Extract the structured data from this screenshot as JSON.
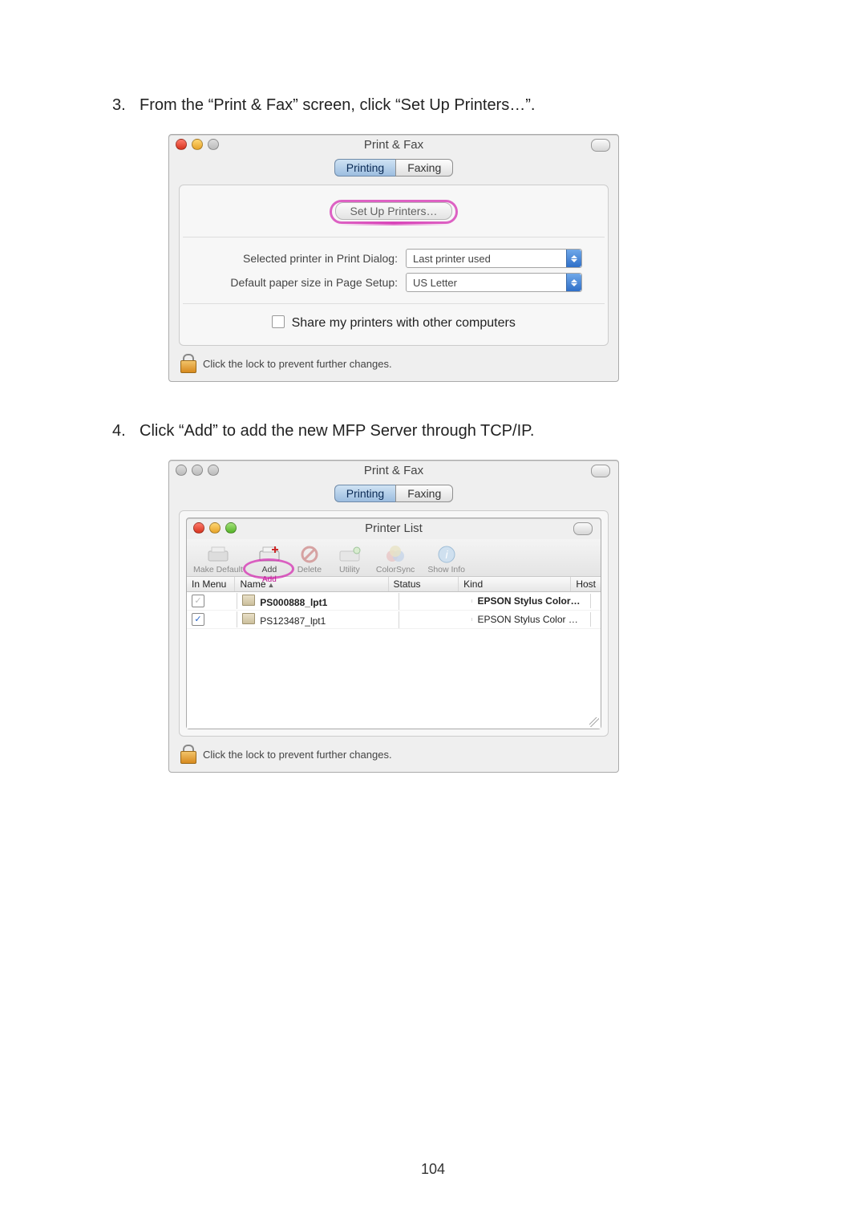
{
  "page_number": "104",
  "steps": {
    "3": {
      "num": "3.",
      "text": "From the “Print & Fax” screen, click “Set Up Printers…”."
    },
    "4": {
      "num": "4.",
      "text": "Click “Add” to add the new MFP Server through TCP/IP."
    }
  },
  "fig1": {
    "title": "Print & Fax",
    "tabs": {
      "printing": "Printing",
      "faxing": "Faxing"
    },
    "setup_btn": "Set Up Printers…",
    "labels": {
      "selected_printer": "Selected printer in Print Dialog:",
      "default_paper": "Default paper size in Page Setup:"
    },
    "selects": {
      "selected_printer": "Last printer used",
      "default_paper": "US Letter"
    },
    "share_label": "Share my printers with other computers",
    "lock_text": "Click the lock to prevent further changes."
  },
  "fig2": {
    "outer_title": "Print & Fax",
    "tabs": {
      "printing": "Printing",
      "faxing": "Faxing"
    },
    "inner_title": "Printer List",
    "toolbar": {
      "make_default": "Make Default",
      "add": "Add",
      "add_highlight": "Add",
      "delete": "Delete",
      "utility": "Utility",
      "colorsync": "ColorSync",
      "showinfo": "Show Info"
    },
    "columns": {
      "in_menu": "In Menu",
      "name": "Name",
      "status": "Status",
      "kind": "Kind",
      "host": "Host"
    },
    "rows": [
      {
        "checked": "gray",
        "name": "PS000888_lpt1",
        "status": "",
        "kind": "EPSON Stylus Color…",
        "host": ""
      },
      {
        "checked": "blue",
        "name": "PS123487_lpt1",
        "status": "",
        "kind": "EPSON Stylus Color …",
        "host": ""
      }
    ],
    "lock_text": "Click the lock to prevent further changes."
  }
}
